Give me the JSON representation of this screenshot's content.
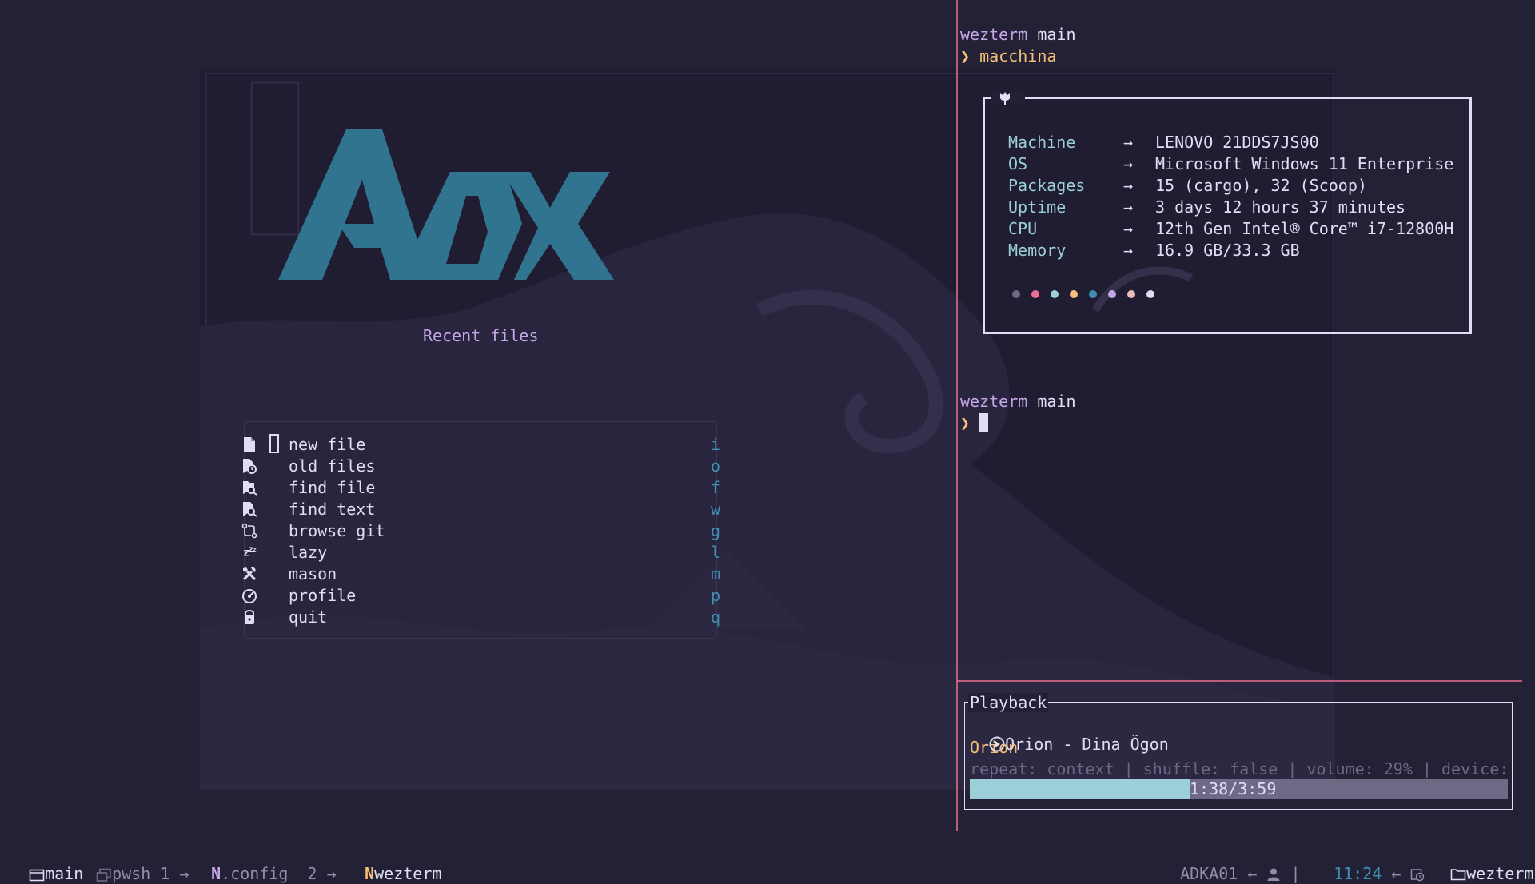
{
  "dashboard": {
    "logo_alt": "Adk",
    "recent_title": "Recent files",
    "menu": [
      {
        "icon": "file-icon",
        "label": "new file",
        "key": "i"
      },
      {
        "icon": "file-clock-icon",
        "label": "old files",
        "key": "o"
      },
      {
        "icon": "file-search-icon",
        "label": "find file",
        "key": "f"
      },
      {
        "icon": "file-text-search-icon",
        "label": "find text",
        "key": "w"
      },
      {
        "icon": "git-compare-icon",
        "label": "browse git",
        "key": "g"
      },
      {
        "icon": "sleep-icon",
        "label": "lazy",
        "key": "l"
      },
      {
        "icon": "tools-icon",
        "label": "mason",
        "key": "m"
      },
      {
        "icon": "gauge-icon",
        "label": "profile",
        "key": "p"
      },
      {
        "icon": "lock-icon",
        "label": "quit",
        "key": "q"
      }
    ]
  },
  "terminal": {
    "prompt1_dir": "wezterm",
    "prompt1_branch": "main",
    "prompt_char": "❯",
    "command": "macchina",
    "info": [
      {
        "key": "Machine",
        "value": "LENOVO 21DDS7JS00"
      },
      {
        "key": "OS",
        "value": "Microsoft Windows 11 Enterprise"
      },
      {
        "key": "Packages",
        "value": "15 (cargo), 32 (Scoop)"
      },
      {
        "key": "Uptime",
        "value": "3 days 12 hours 37 minutes"
      },
      {
        "key": "CPU",
        "value": "12th Gen Intel® Core™ i7-12800H"
      },
      {
        "key": "Memory",
        "value": "16.9 GB/33.3 GB"
      }
    ],
    "arrow": "→",
    "palette": [
      "#6e6a86",
      "#eb6f92",
      "#9ccfd8",
      "#f6c177",
      "#3e8fb0",
      "#c4a7e7",
      "#ebbcba",
      "#e0def4"
    ],
    "prompt2_dir": "wezterm",
    "prompt2_branch": "main"
  },
  "playback": {
    "title": "Playback",
    "track": "Orion - Dina Ögon",
    "album": "Orion",
    "meta": "repeat: context | shuffle: false | volume: 29% | device:",
    "time": "1:38/3:59",
    "progress": 0.41
  },
  "statusbar": {
    "session": "main",
    "tab1_name": "pwsh",
    "tab1_index": "1",
    "tab2_name": ".config",
    "tab2_index": "2",
    "tab3_name": "wezterm",
    "host": "ADKA01",
    "sep": "|",
    "time": "11:24",
    "cwd": "wezterm",
    "arrow_right": "→",
    "arrow_left": "←"
  }
}
